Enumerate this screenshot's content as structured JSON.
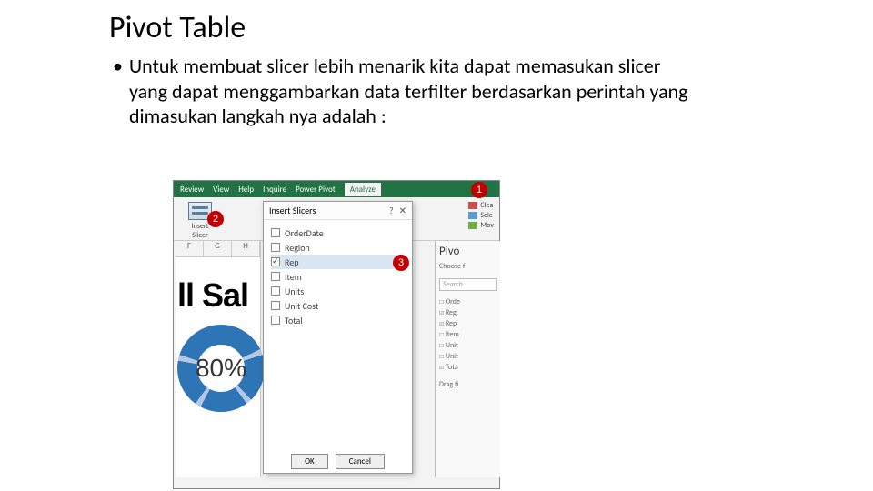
{
  "title": "Pivot Table",
  "body_text": "Untuk membuat slicer lebih menarik kita dapat memasukan slicer yang dapat menggambarkan data terfilter berdasarkan perintah yang dimasukan langkah nya adalah :",
  "badges": {
    "b1": "1",
    "b2": "2",
    "b3": "3"
  },
  "ribbon": {
    "tabs": [
      "Review",
      "View",
      "Help",
      "Inquire",
      "Power Pivot",
      "Analyze"
    ],
    "active_tab": "Analyze",
    "slicer_btn_line1": "Insert",
    "slicer_btn_line2": "Slicer",
    "side_items": [
      "Clea",
      "Sele",
      "Mov"
    ]
  },
  "dialog": {
    "title": "Insert Slicers",
    "close_glyph": "✕",
    "fields": [
      {
        "label": "OrderDate",
        "checked": false,
        "selected": false
      },
      {
        "label": "Region",
        "checked": false,
        "selected": false
      },
      {
        "label": "Rep",
        "checked": true,
        "selected": true
      },
      {
        "label": "Item",
        "checked": false,
        "selected": false
      },
      {
        "label": "Units",
        "checked": false,
        "selected": false
      },
      {
        "label": "Unit Cost",
        "checked": false,
        "selected": false
      },
      {
        "label": "Total",
        "checked": false,
        "selected": false
      }
    ],
    "ok": "OK",
    "cancel": "Cancel"
  },
  "sheet": {
    "cols": [
      "F",
      "G",
      "H"
    ],
    "big_text": "ll Sal",
    "donut_label": "80%"
  },
  "pivot_pane": {
    "title": "Pivo",
    "choose": "Choose f",
    "search_placeholder": "Search",
    "fields": [
      "Orde",
      "Regi",
      "Rep",
      "Item",
      "Unit",
      "Unit",
      "Tota"
    ],
    "checked_idx": [
      1,
      2,
      6
    ],
    "drag": "Drag fi"
  }
}
